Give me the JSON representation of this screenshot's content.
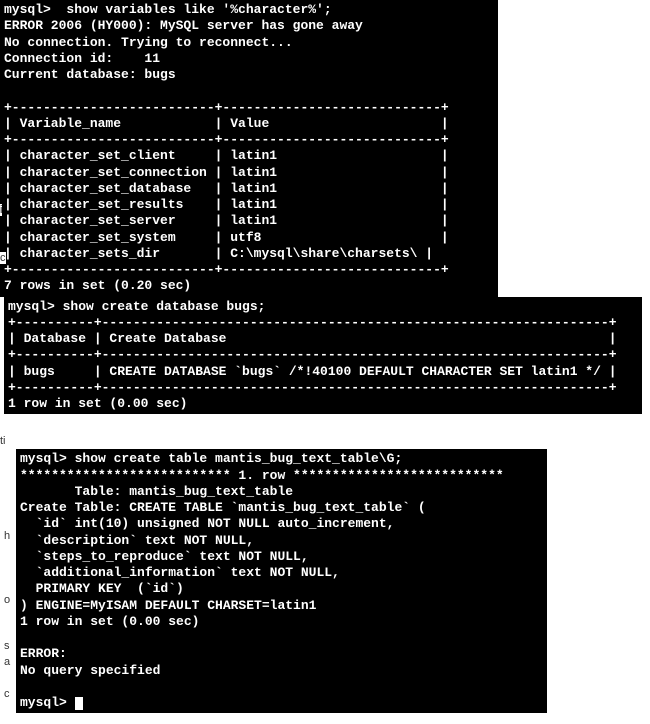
{
  "block1": {
    "prompt": "mysql>  show variables like '%character%';",
    "error": "ERROR 2006 (HY000): MySQL server has gone away",
    "reconnect": "No connection. Trying to reconnect...",
    "conn_id": "Connection id:    11",
    "current_db": "Current database: bugs",
    "sep_top": "+--------------------------+----------------------------+",
    "header": "| Variable_name            | Value                      |",
    "sep_mid": "+--------------------------+----------------------------+",
    "row1": "| character_set_client     | latin1                     |",
    "row2": "| character_set_connection | latin1                     |",
    "row3": "| character_set_database   | latin1                     |",
    "row4": "| character_set_results    | latin1                     |",
    "row5": "| character_set_server     | latin1                     |",
    "row6": "| character_set_system     | utf8                       |",
    "row7": "| character_sets_dir       | C:\\mysql\\share\\charsets\\ |",
    "sep_bot": "+--------------------------+----------------------------+",
    "footer": "7 rows in set (0.20 sec)"
  },
  "block2": {
    "prompt": "mysql> show create database bugs;",
    "sep_top": "+----------+-----------------------------------------------------------------+",
    "header": "| Database | Create Database                                                 |",
    "sep_mid": "+----------+-----------------------------------------------------------------+",
    "row1": "| bugs     | CREATE DATABASE `bugs` /*!40100 DEFAULT CHARACTER SET latin1 */ |",
    "sep_bot": "+----------+-----------------------------------------------------------------+",
    "footer": "1 row in set (0.00 sec)"
  },
  "block3": {
    "prompt": "mysql> show create table mantis_bug_text_table\\G;",
    "rowmark": "*************************** 1. row ***************************",
    "table_line": "       Table: mantis_bug_text_table",
    "ct0": "Create Table: CREATE TABLE `mantis_bug_text_table` (",
    "ct1": "  `id` int(10) unsigned NOT NULL auto_increment,",
    "ct2": "  `description` text NOT NULL,",
    "ct3": "  `steps_to_reproduce` text NOT NULL,",
    "ct4": "  `additional_information` text NOT NULL,",
    "ct5": "  PRIMARY KEY  (`id`)",
    "ct6": ") ENGINE=MyISAM DEFAULT CHARSET=latin1",
    "footer": "1 row in set (0.00 sec)",
    "error": "ERROR:",
    "noquery": "No query specified",
    "prompt2": "mysql> "
  },
  "sidetext": {
    "s1": "i",
    "s2": "c",
    "s3": "ti",
    "s4": "h",
    "s5": "o",
    "s6": "s",
    "s7": "a",
    "s8": "c"
  }
}
